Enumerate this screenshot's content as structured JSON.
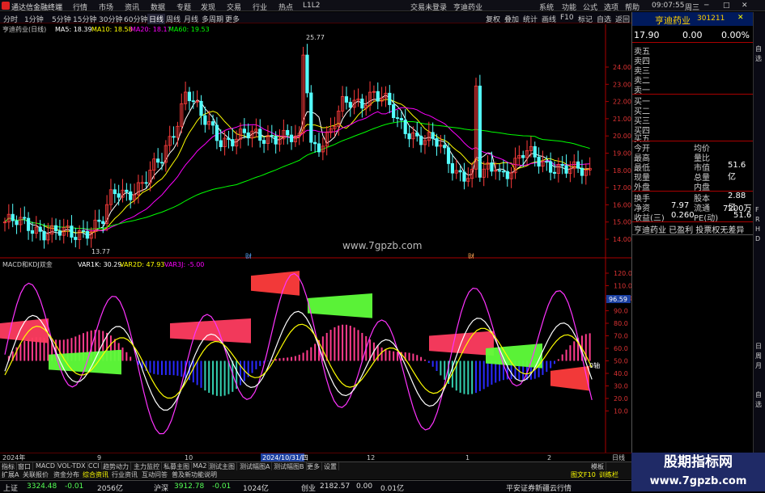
{
  "app": {
    "title": "通达信金融终端",
    "menu": [
      "行情",
      "市场",
      "资讯",
      "数据",
      "专题",
      "发现",
      "交易",
      "行业",
      "热点",
      "L1L2"
    ],
    "login_warning": "交易未登录",
    "stock_link": "亨迪药业",
    "window_menu": [
      "系统",
      "功能",
      "公式",
      "选项",
      "帮助"
    ],
    "clock": "09:07:55",
    "weekday": "周三"
  },
  "toolbar": {
    "periods": [
      "分时",
      "1分钟",
      "5分钟",
      "15分钟",
      "30分钟",
      "60分钟",
      "日线",
      "周线",
      "月线",
      "多周期",
      "更多"
    ],
    "active_period": "日线",
    "actions": [
      "复权",
      "叠加",
      "统计",
      "画线",
      "F10",
      "标记",
      "自选",
      "返回"
    ]
  },
  "main_chart": {
    "stock_label": "亨迪药业(日线)",
    "ma5": "MA5: 18.39",
    "ma10": "MA10: 18.58",
    "ma20": "MA20: 18.17",
    "ma60": "MA60: 19.53",
    "high_label": "25.77",
    "low_label": "13.77",
    "watermark": "www.7gpzb.com",
    "markers": [
      "财",
      "财"
    ],
    "y_ticks": [
      "24.00",
      "23.00",
      "22.00",
      "21.00",
      "20.00",
      "19.00",
      "18.00",
      "17.00",
      "16.00",
      "15.00",
      "14.00"
    ]
  },
  "sub_chart": {
    "label": "MACD和KDJ双金",
    "var1k": "VAR1K: 30.29",
    "var2d": "VAR2D: 47.93",
    "var3j": "VAR3J: -5.00",
    "y_ticks": [
      "120.0",
      "110.0",
      "100.0",
      "90.0",
      "80.0",
      "70.0",
      "60.0",
      "50.0",
      "40.0",
      "30.0",
      "20.0",
      "10.0"
    ],
    "highlight_value": "96.59",
    "zero_axis_label": "0轴"
  },
  "x_axis": {
    "labels": [
      "2024年",
      "9",
      "10",
      "2024/10/31/四",
      "12",
      "1",
      "2"
    ],
    "period": "日线"
  },
  "bottom_tabs": [
    "指标",
    "窗口",
    "MACD",
    "VOL-TDX",
    "CCI",
    "趋势动力",
    "主力监控",
    "私募主图",
    "MA2",
    "测试主图",
    "测试幅图A",
    "测试幅图B",
    "更多",
    "设置",
    "模板"
  ],
  "bottom_tabs2": [
    "扩展A",
    "关联报价",
    "资金分布",
    "综合资讯",
    "行业资讯",
    "互动问答",
    "普及新功能说明"
  ],
  "right_tag": "图文F10",
  "right_tag2": "训练栏",
  "status": {
    "sh_name": "上证",
    "sh_value": "3324.48",
    "sh_change": "-0.01",
    "sh_amount": "2056亿",
    "hs_name": "沪深",
    "hs_value": "3912.78",
    "hs_change": "-0.01",
    "hs_amount": "1024亿",
    "cy_name": "创业",
    "cy_value": "2182.57",
    "cy_change": "0.00",
    "cy_amount": "0.01亿",
    "broker": "平安证券新疆云行情"
  },
  "quote": {
    "name": "亨迪药业",
    "code": "301211",
    "price": "17.90",
    "change": "0.00",
    "change_pct": "0.00%",
    "asks": [
      "卖五",
      "卖四",
      "卖三",
      "卖二",
      "卖一"
    ],
    "bids": [
      "买一",
      "买二",
      "买三",
      "买四",
      "买五"
    ],
    "fields": [
      {
        "l": "今开",
        "v": "",
        "l2": "均价",
        "v2": ""
      },
      {
        "l": "最高",
        "v": "",
        "l2": "量比",
        "v2": ""
      },
      {
        "l": "最低",
        "v": "",
        "l2": "市值",
        "v2": "51.6亿"
      },
      {
        "l": "现量",
        "v": "",
        "l2": "总量",
        "v2": ""
      },
      {
        "l": "外盘",
        "v": "",
        "l2": "内盘",
        "v2": ""
      },
      {
        "l": "换手",
        "v": "",
        "l2": "股本",
        "v2": "2.88亿"
      },
      {
        "l": "净资",
        "v": "7.97",
        "l2": "流通",
        "v2": "7200万"
      },
      {
        "l": "收益(三)",
        "v": "0.260",
        "l2": "PE(动)",
        "v2": "51.6"
      }
    ],
    "note": "亨迪药业 已盈利 投票权无差异"
  },
  "side_tools": [
    "自",
    "选",
    "F",
    "R",
    "H",
    "D",
    "日",
    "周",
    "月",
    "自",
    "选"
  ],
  "brand_watermark": [
    "股期指标网",
    "www.7gpzb.com"
  ],
  "colors": {
    "up": "#ff3c3c",
    "down": "#54ffff",
    "ma5": "#ffffff",
    "ma10": "#ffff00",
    "ma20": "#ff00ff",
    "ma60": "#00ff00",
    "accent": "#ffd000"
  }
}
